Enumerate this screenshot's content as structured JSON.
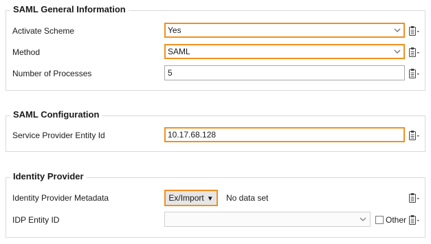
{
  "saml_general": {
    "title": "SAML General Information",
    "activate_scheme": {
      "label": "Activate Scheme",
      "value": "Yes"
    },
    "method": {
      "label": "Method",
      "value": "SAML"
    },
    "num_processes": {
      "label": "Number of Processes",
      "value": "5"
    }
  },
  "saml_config": {
    "title": "SAML Configuration",
    "sp_entity_id": {
      "label": "Service Provider Entity Id",
      "value": "10.17.68.128"
    }
  },
  "identity_provider": {
    "title": "Identity Provider",
    "metadata": {
      "label": "Identity Provider Metadata",
      "button_label": "Ex/Import",
      "status": "No data set"
    },
    "idp_entity_id": {
      "label": "IDP Entity ID",
      "value": "",
      "other_label": "Other",
      "other_checked": false
    }
  },
  "colors": {
    "accent": "#f0901f",
    "border": "#d9d9d9"
  },
  "icons": {
    "field_options": "clipboard-dropdown-icon",
    "select_arrow": "chevron-down-icon"
  }
}
